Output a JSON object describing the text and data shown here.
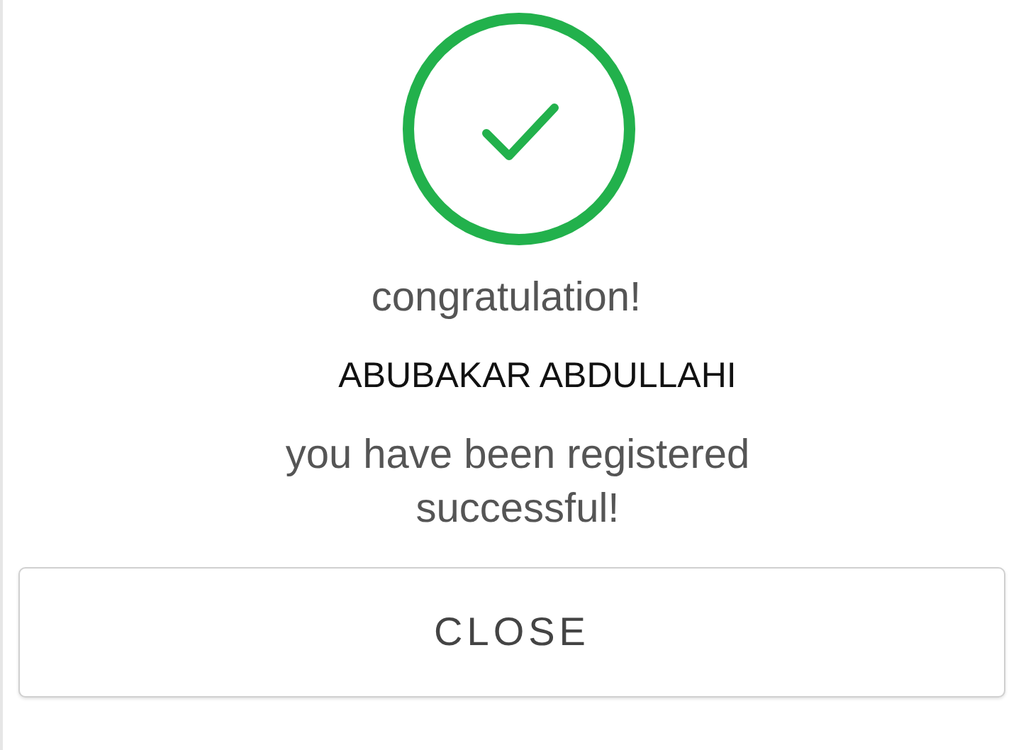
{
  "dialog": {
    "heading": "congratulation!",
    "name": "ABUBAKAR ABDULLAHI",
    "message": "you have been registered successful!",
    "buttons": [
      "CLOSE"
    ]
  }
}
